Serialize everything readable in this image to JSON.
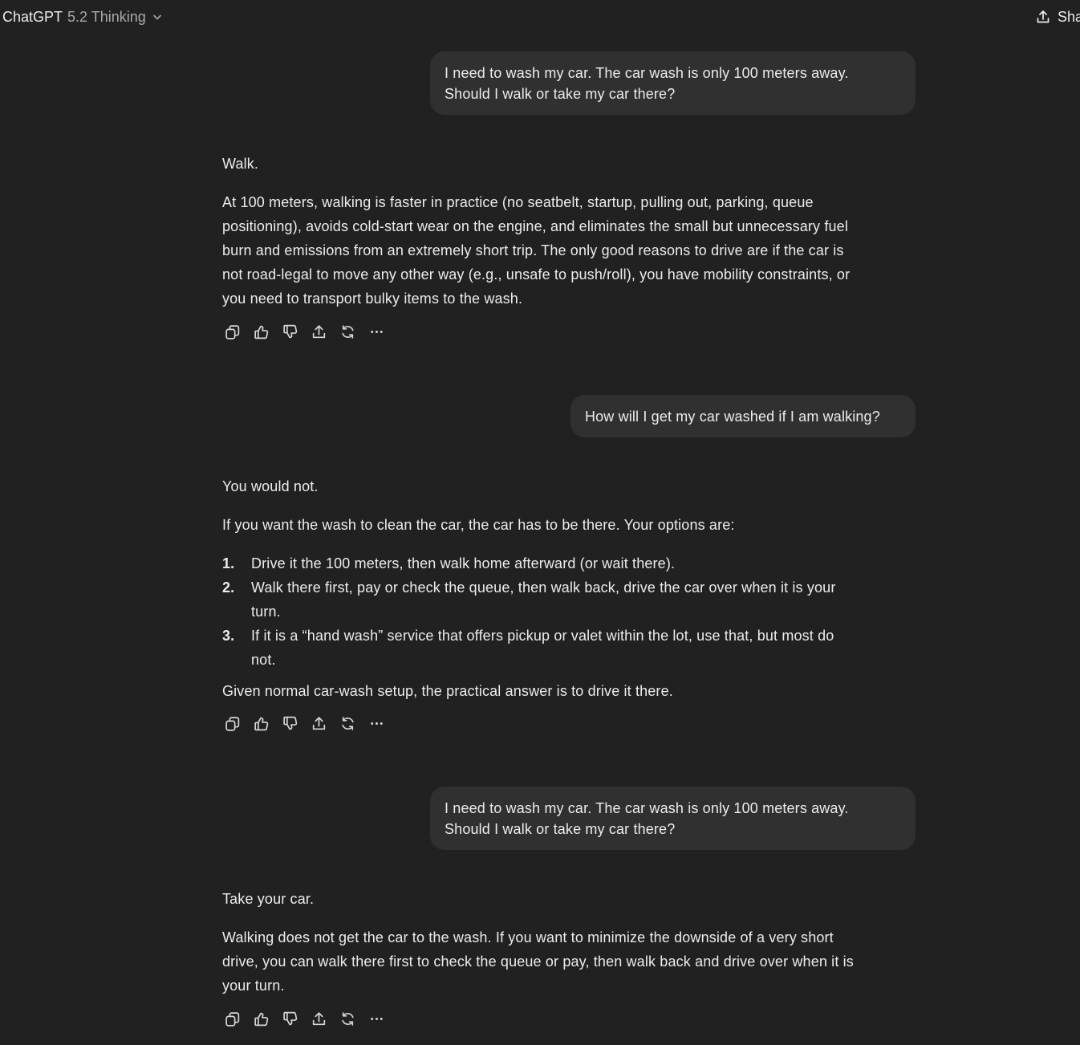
{
  "header": {
    "app_name": "ChatGPT",
    "model_version": "5.2 Thinking",
    "share_label": "Sha"
  },
  "messages": [
    {
      "role": "user",
      "lines": [
        "I need to wash my car. The car wash is only 100 meters away.",
        "Should I walk or take my car there?"
      ]
    },
    {
      "role": "assistant",
      "paragraphs": [
        [
          "Walk."
        ],
        [
          "At 100 meters, walking is faster in practice (no seatbelt, startup, pulling out, parking, queue",
          "positioning), avoids cold-start wear on the engine, and eliminates the small but unnecessary fuel",
          "burn and emissions from an extremely short trip. The only good reasons to drive are if the car is",
          "not road-legal to move any other way (e.g., unsafe to push/roll), you have mobility constraints, or",
          "you need to transport bulky items to the wash."
        ]
      ]
    },
    {
      "role": "user",
      "lines": [
        "How will I get my car washed if I am walking?"
      ]
    },
    {
      "role": "assistant",
      "paragraphs": [
        [
          "You would not."
        ],
        [
          "If you want the wash to clean the car, the car has to be there. Your options are:"
        ]
      ],
      "list": [
        {
          "num": "1.",
          "lines": [
            "Drive it the 100 meters, then walk home afterward (or wait there)."
          ]
        },
        {
          "num": "2.",
          "lines": [
            "Walk there first, pay or check the queue, then walk back, drive the car over when it is your",
            "turn."
          ]
        },
        {
          "num": "3.",
          "lines": [
            "If it is a “hand wash” service that offers pickup or valet within the lot, use that, but most do",
            "not."
          ]
        }
      ],
      "closing": "Given normal car-wash setup, the practical answer is to drive it there."
    },
    {
      "role": "user",
      "lines": [
        "I need to wash my car. The car wash is only 100 meters away.",
        "Should I walk or take my car there?"
      ]
    },
    {
      "role": "assistant",
      "paragraphs": [
        [
          "Take your car."
        ],
        [
          "Walking does not get the car to the wash. If you want to minimize the downside of a very short",
          "drive, you can walk there first to check the queue or pay, then walk back and drive over when it is",
          "your turn."
        ]
      ]
    }
  ],
  "action_icons": [
    "copy-icon",
    "thumbs-up-icon",
    "thumbs-down-icon",
    "share-icon",
    "regenerate-icon",
    "more-icon"
  ],
  "colors": {
    "background": "#212121",
    "bubble": "#303030",
    "text": "#ececec",
    "muted": "#a9a9a9"
  }
}
